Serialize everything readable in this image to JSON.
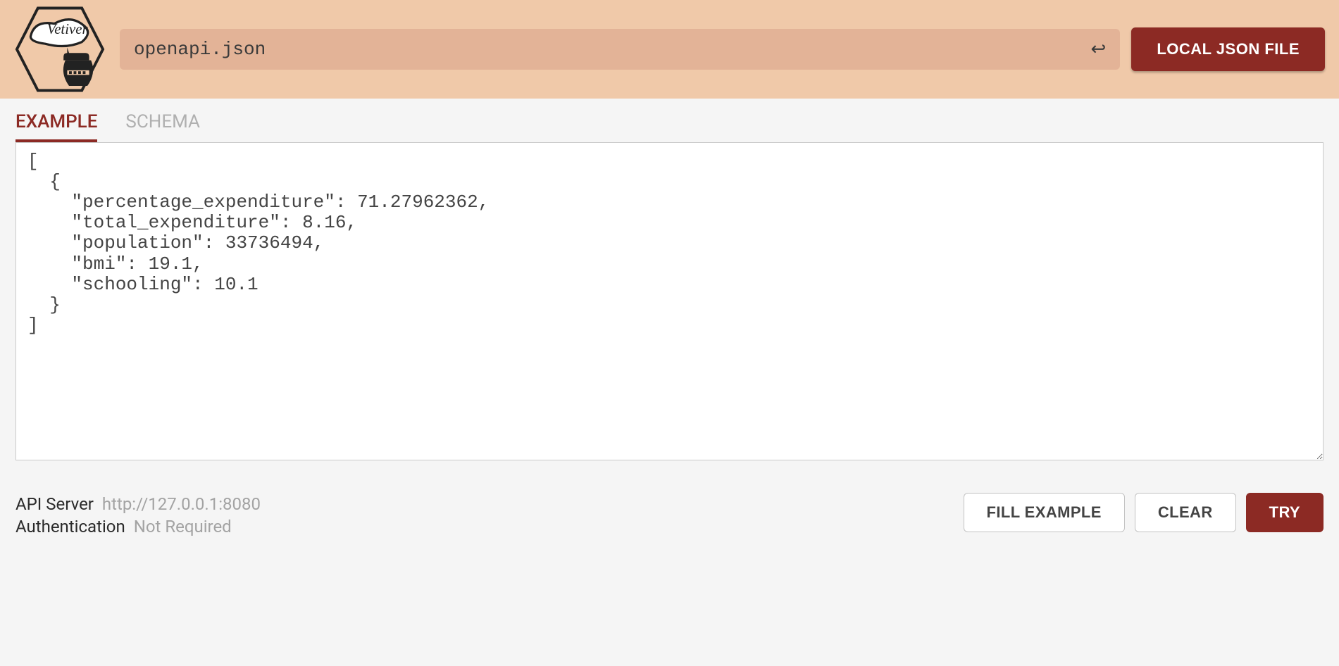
{
  "header": {
    "logo_label": "Vetiver",
    "url_input_value": "openapi.json",
    "local_json_label": "LOCAL JSON FILE"
  },
  "tabs": {
    "example": "EXAMPLE",
    "schema": "SCHEMA"
  },
  "editor": {
    "content": "[\n  {\n    \"percentage_expenditure\": 71.27962362,\n    \"total_expenditure\": 8.16,\n    \"population\": 33736494,\n    \"bmi\": 19.1,\n    \"schooling\": 10.1\n  }\n]"
  },
  "footer": {
    "api_server_label": "API Server",
    "api_server_value": "http://127.0.0.1:8080",
    "auth_label": "Authentication",
    "auth_value": "Not Required",
    "fill_example_label": "FILL EXAMPLE",
    "clear_label": "CLEAR",
    "try_label": "TRY"
  }
}
